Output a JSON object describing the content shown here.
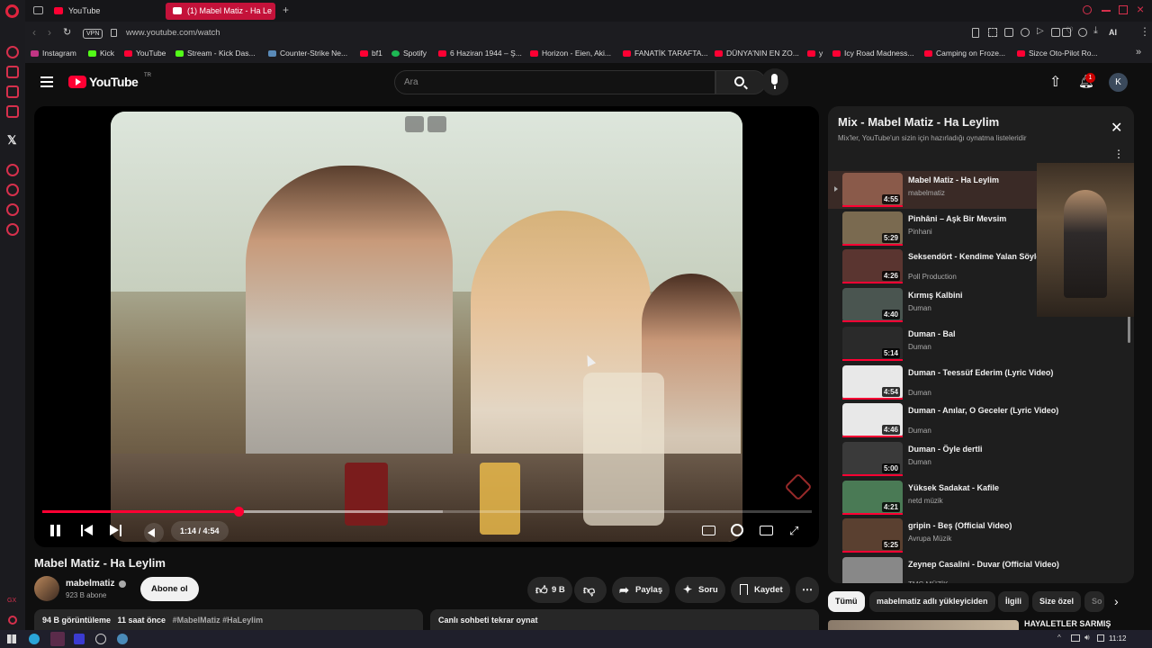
{
  "browser": {
    "tabs": [
      {
        "label": "YouTube"
      },
      {
        "label": "(1) Mabel Matiz - Ha Le"
      }
    ],
    "url": "www.youtube.com/watch",
    "vpn": "VPN",
    "ai_label": "AI",
    "bookmarks": [
      {
        "label": "Instagram"
      },
      {
        "label": "Kick"
      },
      {
        "label": "YouTube"
      },
      {
        "label": "Stream - Kick Das..."
      },
      {
        "label": "Counter-Strike Ne..."
      },
      {
        "label": "bf1"
      },
      {
        "label": "Spotify"
      },
      {
        "label": "6 Haziran 1944 – Ş..."
      },
      {
        "label": "Horizon - Eien, Aki..."
      },
      {
        "label": "FANATİK TARAFTA..."
      },
      {
        "label": "DÜNYA'NIN EN ZO..."
      },
      {
        "label": "y"
      },
      {
        "label": "Icy Road Madness..."
      },
      {
        "label": "Camping on Froze..."
      },
      {
        "label": "Sizce Oto-Pilot Ro..."
      }
    ]
  },
  "header": {
    "logo": "YouTube",
    "logo_sup": "TR",
    "search_placeholder": "Ara",
    "notification_count": "1",
    "avatar_letter": "K"
  },
  "player": {
    "time": "1:14 / 4:54",
    "progress": 0.255,
    "buffered": 0.52
  },
  "video": {
    "title": "Mabel Matiz - Ha Leylim",
    "channel": "mabelmatiz",
    "subscribers": "923 B abone",
    "subscribe_label": "Abone ol",
    "likes": "9 B",
    "share_label": "Paylaş",
    "ask_label": "Soru",
    "save_label": "Kaydet",
    "views": "94 B görüntüleme",
    "age": "11 saat önce",
    "hashtags": "#MabelMatiz #HaLeylim",
    "chat_replay": "Canlı sohbeti tekrar oynat"
  },
  "playlist": {
    "title": "Mix - Mabel Matiz - Ha Leylim",
    "subtitle": "Mix'ler, YouTube'un sizin için hazırladığı oynatma listeleridir",
    "items": [
      {
        "title": "Mabel Matiz - Ha Leylim",
        "channel": "mabelmatiz",
        "duration": "4:55",
        "color": "#8a5a4a"
      },
      {
        "title": "Pinhâni – Aşk Bir Mevsim",
        "channel": "Pinhani",
        "duration": "5:29",
        "color": "#7a6a50"
      },
      {
        "title": "Seksendört - Kendime Yalan Söyle Video )",
        "channel": "Poll Production",
        "duration": "4:26",
        "color": "#5a3530"
      },
      {
        "title": "Kırmış Kalbini",
        "channel": "Duman",
        "duration": "4:40",
        "color": "#4a5550"
      },
      {
        "title": "Duman - Bal",
        "channel": "Duman",
        "duration": "5:14",
        "color": "#2a2a2a"
      },
      {
        "title": "Duman - Teessüf Ederim (Lyric Video)",
        "channel": "Duman",
        "duration": "4:54",
        "color": "#e8e8e8"
      },
      {
        "title": "Duman - Anılar, O Geceler (Lyric Video)",
        "channel": "Duman",
        "duration": "4:46",
        "color": "#e8e8e8"
      },
      {
        "title": "Duman - Öyle dertli",
        "channel": "Duman",
        "duration": "5:00",
        "color": "#3a3a3a"
      },
      {
        "title": "Yüksek Sadakat - Kafile",
        "channel": "netd müzik",
        "duration": "4:21",
        "color": "#4a7a55"
      },
      {
        "title": "gripin - Beş (Official Video)",
        "channel": "Avrupa Müzik",
        "duration": "5:25",
        "color": "#5a4030"
      },
      {
        "title": "Zeynep Casalini - Duvar (Official Video)",
        "channel": "TMC MÜZİK",
        "duration": "",
        "color": "#888"
      }
    ]
  },
  "chips": [
    {
      "label": "Tümü"
    },
    {
      "label": "mabelmatiz adlı yükleyiciden"
    },
    {
      "label": "İlgili"
    },
    {
      "label": "Size özel"
    },
    {
      "label": "So"
    }
  ],
  "recommended": {
    "title": "HAYALETLER SARMIŞ"
  },
  "taskbar": {
    "time": "11:12"
  }
}
